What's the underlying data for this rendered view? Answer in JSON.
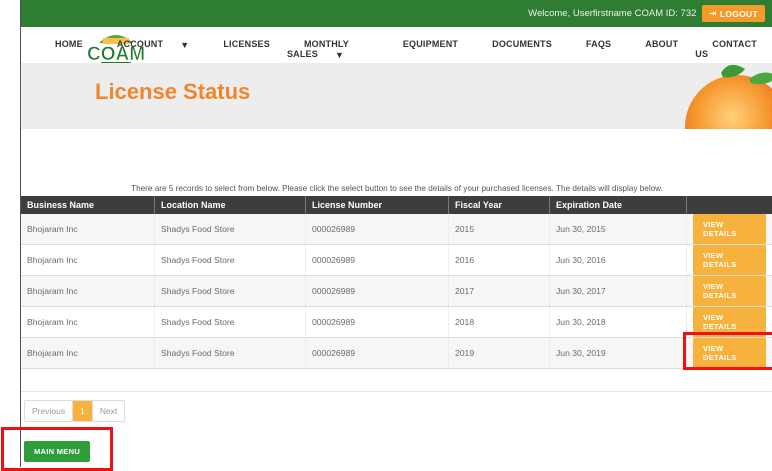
{
  "topbar": {
    "welcome": "Welcome, Userfirstname COAM ID: 732",
    "logout": "LOGOUT"
  },
  "logo": {
    "text": "COAM",
    "subtext": "DIVISION"
  },
  "nav": {
    "items": [
      {
        "label": "HOME"
      },
      {
        "label": "ACCOUNT",
        "dropdown": true
      },
      {
        "label": "LICENSES"
      },
      {
        "label": "MONTHLY SALES",
        "dropdown": true
      },
      {
        "label": "EQUIPMENT"
      },
      {
        "label": "DOCUMENTS"
      },
      {
        "label": "FAQS"
      },
      {
        "label": "ABOUT"
      },
      {
        "label": "CONTACT US"
      }
    ]
  },
  "hero": {
    "title": "License Status"
  },
  "info": "There are 5 records to select from below. Please click the select button to see the details of your purchased licenses. The details will display below.",
  "table": {
    "headers": [
      "Business Name",
      "Location Name",
      "License Number",
      "Fiscal Year",
      "Expiration Date",
      ""
    ],
    "rows": [
      {
        "business": "Bhojaram Inc",
        "location": "Shadys Food Store",
        "license": "000026989",
        "year": "2015",
        "expires": "Jun 30, 2015",
        "action": "VIEW DETAILS"
      },
      {
        "business": "Bhojaram Inc",
        "location": "Shadys Food Store",
        "license": "000026989",
        "year": "2016",
        "expires": "Jun 30, 2016",
        "action": "VIEW DETAILS"
      },
      {
        "business": "Bhojaram Inc",
        "location": "Shadys Food Store",
        "license": "000026989",
        "year": "2017",
        "expires": "Jun 30, 2017",
        "action": "VIEW DETAILS"
      },
      {
        "business": "Bhojaram Inc",
        "location": "Shadys Food Store",
        "license": "000026989",
        "year": "2018",
        "expires": "Jun 30, 2018",
        "action": "VIEW DETAILS"
      },
      {
        "business": "Bhojaram Inc",
        "location": "Shadys Food Store",
        "license": "000026989",
        "year": "2019",
        "expires": "Jun 30, 2019",
        "action": "VIEW DETAILS"
      }
    ]
  },
  "pager": {
    "previous": "Previous",
    "current": "1",
    "next": "Next"
  },
  "main_menu": "MAIN MENU",
  "colors": {
    "brand_green": "#2f7d32",
    "accent_orange": "#f0862b",
    "button_yellow": "#f6b23c",
    "highlight_red": "#ee1111"
  }
}
